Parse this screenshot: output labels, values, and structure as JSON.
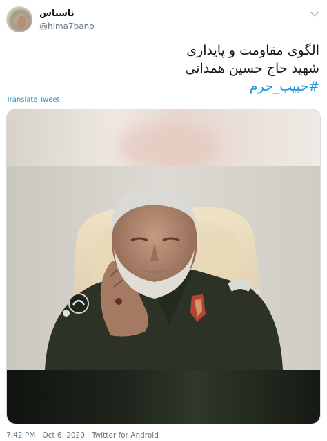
{
  "author": {
    "display_name": "ناشناس",
    "handle": "@hima7bano"
  },
  "tweet": {
    "line1": "الگوی مقاومت و پایداری",
    "line2": "شهید حاج حسین همدانی",
    "hashtag": "#حبیب_حرم"
  },
  "translate_label": "Translate Tweet",
  "footer": {
    "time": "7:42 PM",
    "date": "Oct 6, 2020",
    "source": "Twitter for Android",
    "separator": "·"
  },
  "colors": {
    "link": "#1b95e0",
    "secondary_text": "#657786"
  },
  "icons": {
    "menu": "chevron-down-icon"
  }
}
